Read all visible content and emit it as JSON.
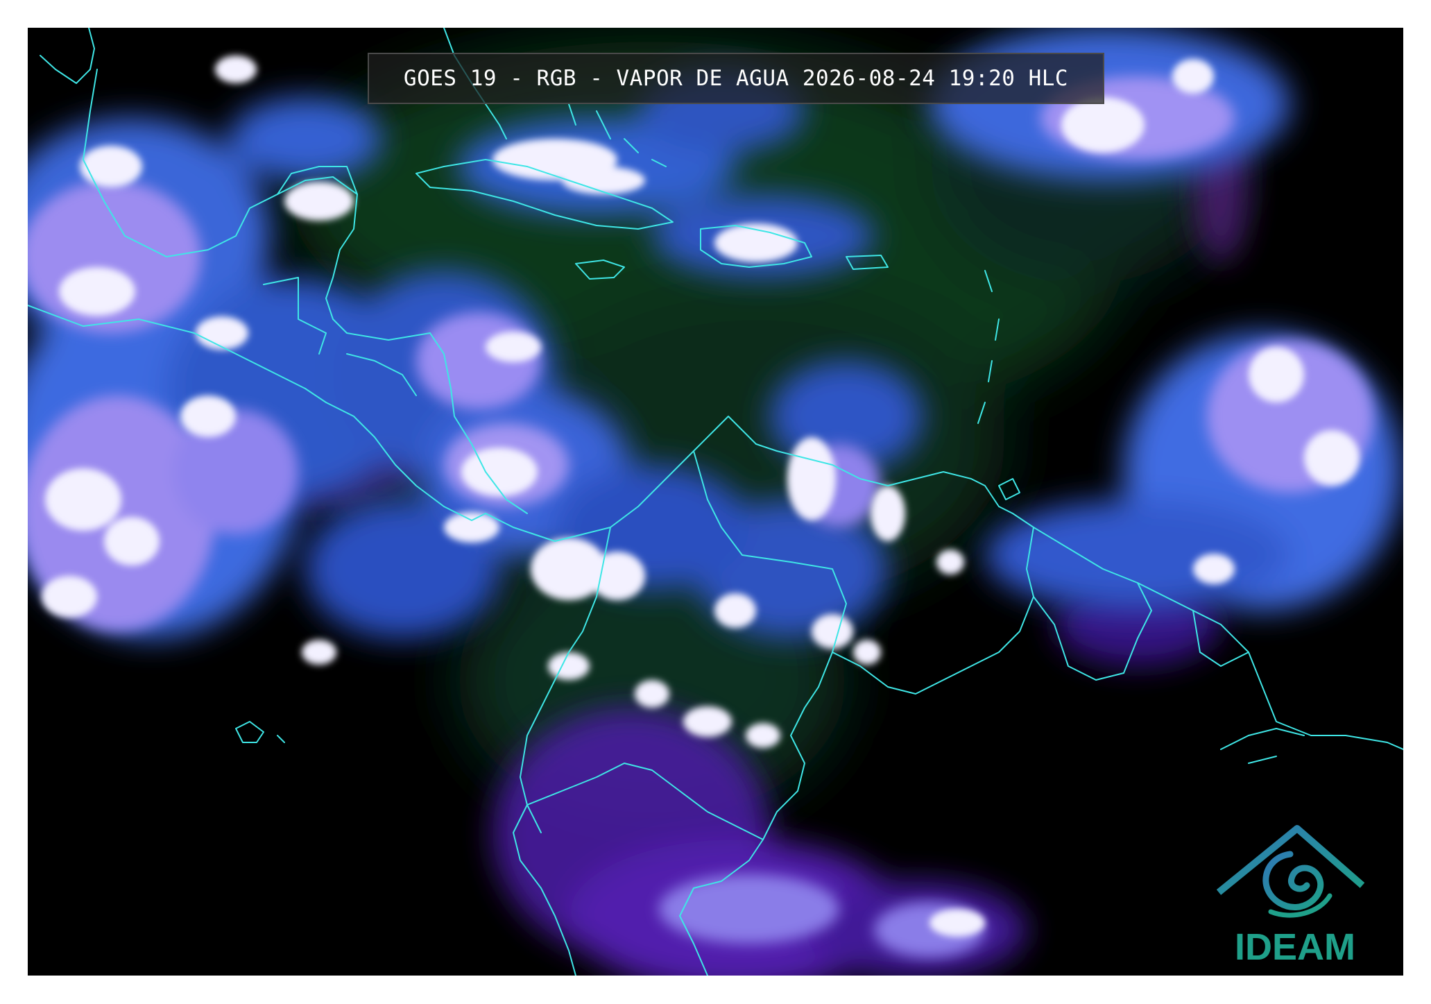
{
  "header": {
    "title": "GOES 19 - RGB - VAPOR DE AGUA 2026-08-24 19:20 HLC"
  },
  "logo": {
    "text": "IDEAM",
    "icon": "ideam-mountain-swirl-icon"
  },
  "colors": {
    "background": "#000000",
    "border_lines": "#3fe6e6",
    "logo_teal": "#1fa08a",
    "logo_blue": "#2f78b5",
    "cloud_white": "#f2f0ff",
    "cloud_lavender": "#a89af5",
    "cloud_blue": "#3f6fe0",
    "vapor_green": "#0b3a1c",
    "vapor_purple": "#5a1fb0"
  }
}
